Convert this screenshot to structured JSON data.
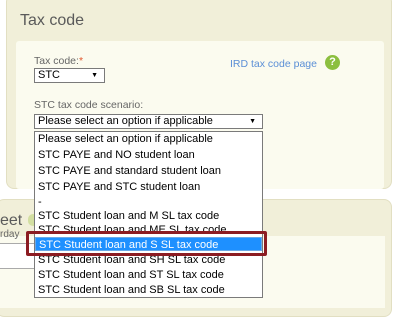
{
  "tax_code_section": {
    "title": "Tax code",
    "tax_code_label": "Tax code:",
    "required_marker": "*",
    "tax_code_value": "STC",
    "ird_link_label": "IRD tax code page",
    "help_icon_glyph": "?",
    "scenario_label": "STC tax code scenario:",
    "scenario_value": "Please select an option if applicable"
  },
  "dropdown": {
    "options": [
      "Please select an option if applicable",
      "STC PAYE and NO student loan",
      "STC PAYE and standard student loan",
      "STC PAYE and STC student loan",
      "-",
      "STC Student loan and M SL tax code",
      "STC Student loan and ME SL tax code",
      "STC Student loan and S SL tax code",
      "STC Student loan and SH SL tax code",
      "STC Student loan and ST SL tax code",
      "STC Student loan and SB SL tax code"
    ],
    "selected_index": 7
  },
  "sheet_section": {
    "title_fragment": "eet",
    "label_fragment": "rday"
  },
  "colors": {
    "card_bg": "#f1efd9",
    "inner_bg": "#fbfbef",
    "selection": "#1e90ff",
    "callout": "#8c1c22",
    "link": "#5b8fd6",
    "help_icon": "#8cbf3f"
  },
  "icons": {
    "help": "help-icon",
    "select_arrow": "chevron-down-icon"
  }
}
